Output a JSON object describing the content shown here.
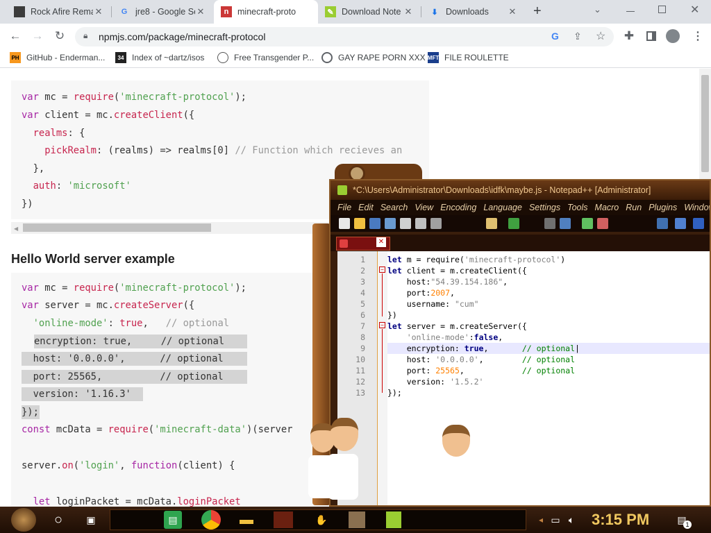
{
  "browser": {
    "tabs": [
      {
        "title": "Rock Afire Rema",
        "icon": "dark-square-favicon",
        "active": false
      },
      {
        "title": "jre8 - Google Se",
        "icon": "google-favicon",
        "active": false
      },
      {
        "title": "minecraft-proto",
        "icon": "npm-favicon",
        "active": true
      },
      {
        "title": "Download Note",
        "icon": "notepadpp-favicon",
        "active": false
      },
      {
        "title": "Downloads",
        "icon": "download-icon",
        "active": false
      }
    ],
    "new_tab": "+",
    "url": "npmjs.com/package/minecraft-protocol",
    "bookmarks": [
      {
        "label": "GitHub - Enderman...",
        "icon": "PH"
      },
      {
        "label": "Index of ~dartz/isos",
        "icon": "34"
      },
      {
        "label": "Free Transgender P...",
        "icon": "mask-icon"
      },
      {
        "label": "GAY RAPE PORN XXX",
        "icon": "globe-icon"
      },
      {
        "label": "FILE ROULETTE",
        "icon": "MFT"
      }
    ]
  },
  "page": {
    "code1": [
      "var mc = require('minecraft-protocol');",
      "var client = mc.createClient({",
      "  realms: {",
      "    pickRealm: (realms) => realms[0] // Function which recieves an",
      "  },",
      "  auth: 'microsoft'",
      "})"
    ],
    "heading": "Hello World server example",
    "code2": [
      "var mc = require('minecraft-protocol');",
      "var server = mc.createServer({",
      "  'online-mode': true,   // optional",
      "  encryption: true,     // optional",
      "  host: '0.0.0.0',      // optional",
      "  port: 25565,          // optional",
      "  version: '1.16.3'",
      "});",
      "const mcData = require('minecraft-data')(server",
      "",
      "server.on('login', function(client) {",
      "",
      "  let loginPacket = mcData.loginPacket"
    ]
  },
  "notepad": {
    "title": "*C:\\Users\\Administrator\\Downloads\\idfk\\maybe.js - Notepad++ [Administrator]",
    "menu": [
      "File",
      "Edit",
      "Search",
      "View",
      "Encoding",
      "Language",
      "Settings",
      "Tools",
      "Macro",
      "Run",
      "Plugins",
      "Window"
    ],
    "tab_close": "✕",
    "line_numbers": [
      "1",
      "2",
      "3",
      "4",
      "5",
      "6",
      "7",
      "8",
      "9",
      "10",
      "11",
      "12",
      "13"
    ],
    "lines": [
      "let m = require('minecraft-protocol')",
      "let client = m.createClient({",
      "    host:\"54.39.154.186\",",
      "    port:2007,",
      "    username: \"cum\"",
      "})",
      "let server = m.createServer({",
      "    'online-mode':false,",
      "    encryption: true,       // optional",
      "    host: '0.0.0.0',        // optional",
      "    port: 25565,            // optional",
      "    version: '1.5.2'",
      "});"
    ]
  },
  "taskbar": {
    "clock": "3:15 PM",
    "notification_count": "1"
  },
  "colors": {
    "accent": "#c7254e",
    "npp_frame": "#3a1e0c",
    "clock": "#f0c860"
  }
}
